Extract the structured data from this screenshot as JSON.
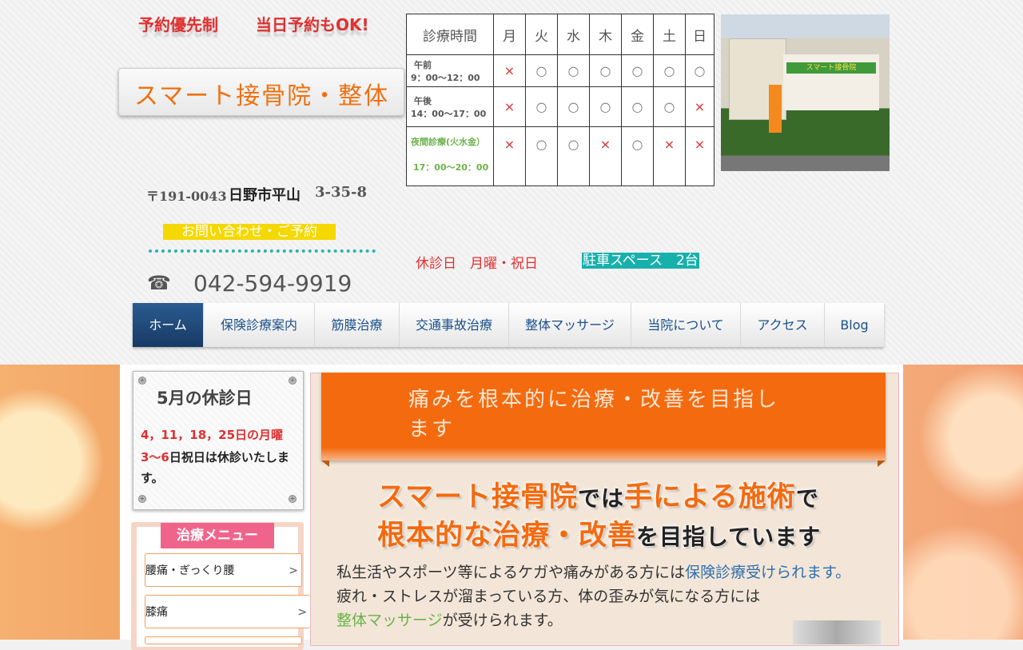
{
  "header": {
    "promo_left": "予約優先制",
    "promo_right": "当日予約もOK!",
    "clinic_name": "スマート接骨院・整体",
    "postal": "〒191-0043",
    "city": "日野市平山",
    "street": "3-35-8",
    "contact_label": "お問い合わせ・ご予約",
    "phone_icon": "☎",
    "phone": "042-594-9919",
    "closed_days": "休診日　月曜・祝日",
    "parking": "駐車スペース　2台"
  },
  "schedule": {
    "corner": "診療時間",
    "days": [
      "月",
      "火",
      "水",
      "木",
      "金",
      "土",
      "日"
    ],
    "rows": [
      {
        "label": "午前",
        "time": "9：00～12：00",
        "marks": [
          "×",
          "○",
          "○",
          "○",
          "○",
          "○",
          "○"
        ]
      },
      {
        "label": "午後",
        "time": "14：00～17：00",
        "marks": [
          "×",
          "○",
          "○",
          "○",
          "○",
          "○",
          "×"
        ]
      },
      {
        "label": "夜間診療(火水金）",
        "time": "17：00～20：00",
        "marks": [
          "×",
          "○",
          "○",
          "×",
          "○",
          "×",
          "×"
        ]
      }
    ]
  },
  "photo": {
    "sign_text": "スマート接骨院"
  },
  "nav": {
    "items": [
      "ホーム",
      "保険診療案内",
      "筋膜治療",
      "交通事故治療",
      "整体マッサージ",
      "当院について",
      "アクセス",
      "Blog"
    ]
  },
  "notice": {
    "title": "5月の休診日",
    "line1": "4，11，18，25日の月曜",
    "line2_red": "3～6",
    "line2_rest": "日祝日は休診いたします。"
  },
  "menu": {
    "title": "治療メニュー",
    "items": [
      {
        "label": "腰痛・ぎっくり腰",
        "arrow": ">"
      },
      {
        "label": "膝痛",
        "arrow": ">"
      }
    ]
  },
  "main": {
    "ribbon": "痛みを根本的に治療・改善を目指します",
    "hl1_a": "スマート接骨院",
    "hl1_b": "では",
    "hl1_c": "手による施術",
    "hl1_d": "で",
    "hl2_a": "根本的な治療・改善",
    "hl2_b": "を目指しています",
    "p1_a": "私生活やスポーツ等によるケガや痛みがある方には",
    "p1_b": "保険診療受けられます。",
    "p2": "疲れ・ストレスが溜まっている方、体の歪みが気になる方には",
    "p3_a": "整体マッサージ",
    "p3_b": "が受けられます。"
  }
}
